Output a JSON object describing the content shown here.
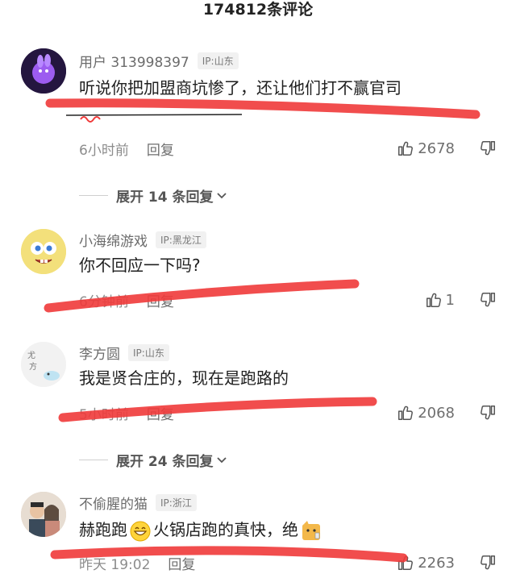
{
  "header": {
    "title": "174812条评论"
  },
  "comments": [
    {
      "username": "用户 313998397",
      "ip": "IP:山东",
      "text": "听说你把加盟商坑惨了，还让他们打不赢官司",
      "time": "6小时前",
      "reply": "回复",
      "likes": "2678"
    },
    {
      "username": "小海绵游戏",
      "ip": "IP:黑龙江",
      "text": "你不回应一下吗?",
      "time": "6分钟前",
      "reply": "回复",
      "likes": "1"
    },
    {
      "username": "李方圆",
      "ip": "IP:山东",
      "text": "我是贤合庄的，现在是跑路的",
      "time": "5小时前",
      "reply": "回复",
      "likes": "2068"
    },
    {
      "username": "不偷腥的猫",
      "ip": "IP:浙江",
      "text_part1": "赫跑跑",
      "text_part2": "火锅店跑的真快，绝",
      "time": "昨天 19:02",
      "reply": "回复",
      "likes": "2263"
    }
  ],
  "expanders": [
    {
      "label": "展开 14 条回复"
    },
    {
      "label": "展开 24 条回复"
    }
  ],
  "colors": {
    "highlight_red": "#f03a3a",
    "muted_text": "#8c8c8c"
  },
  "icons": [
    "thumbs-up-icon",
    "thumbs-down-icon",
    "chevron-down-icon"
  ]
}
